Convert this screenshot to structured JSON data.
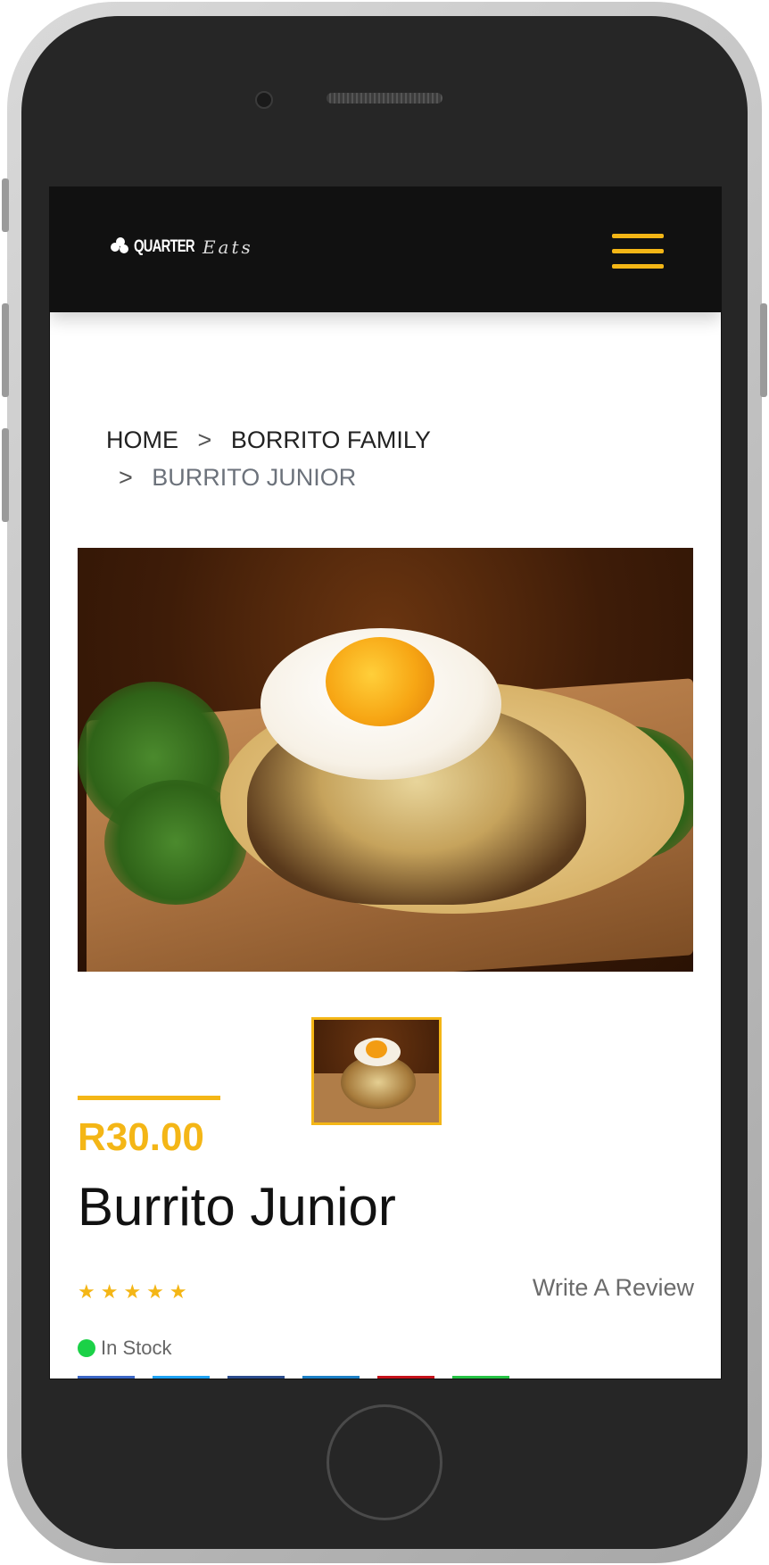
{
  "nav": {
    "logo_main": "QUARTER",
    "logo_script": "Eats"
  },
  "breadcrumb": {
    "home": "HOME",
    "separator": ">",
    "category": "BORRITO FAMILY",
    "current": "BURRITO JUNIOR"
  },
  "product": {
    "price": "R30.00",
    "name": "Burrito Junior",
    "rating": 5,
    "stars": "★★★★★",
    "review_link": "Write A Review",
    "stock_status": "In Stock"
  },
  "colors": {
    "accent": "#f4b616",
    "navbar": "#111111",
    "in_stock": "#1bd147",
    "share_buttons": [
      "#3b66c4",
      "#1da1f2",
      "#2b4c8c",
      "#1b7fc4",
      "#c4121a",
      "#25c244"
    ]
  }
}
